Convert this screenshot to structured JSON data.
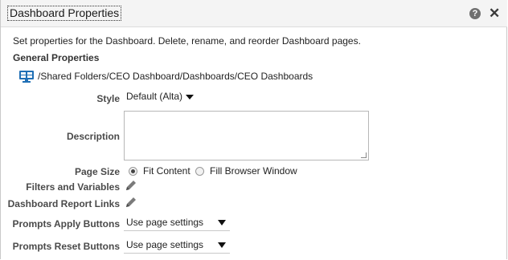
{
  "dialog": {
    "title": "Dashboard Properties",
    "help_symbol": "?",
    "close_symbol": "✕",
    "intro": "Set properties for the Dashboard. Delete, rename, and reorder Dashboard pages.",
    "section_title": "General Properties",
    "path": "/Shared Folders/CEO Dashboard/Dashboards/CEO Dashboards"
  },
  "form": {
    "style_label": "Style",
    "style_value": "Default (Alta)",
    "description_label": "Description",
    "description_value": "",
    "page_size_label": "Page Size",
    "page_size_options": [
      "Fit Content",
      "Fill Browser Window"
    ],
    "page_size_selected": "Fit Content",
    "filters_label": "Filters and Variables",
    "report_links_label": "Dashboard Report Links",
    "prompts_apply_label": "Prompts Apply Buttons",
    "prompts_apply_value": "Use page settings",
    "prompts_reset_label": "Prompts Reset Buttons",
    "prompts_reset_value": "Use page settings"
  },
  "icons": {
    "path_icon": "dashboard-monitor-icon",
    "edit_icon": "pencil-icon",
    "help_icon": "help-icon",
    "close_icon": "close-icon"
  },
  "colors": {
    "accent_blue": "#1f6fb5",
    "label_gray": "#4a4a4a",
    "titlebar_bg": "#f4f4f4"
  }
}
